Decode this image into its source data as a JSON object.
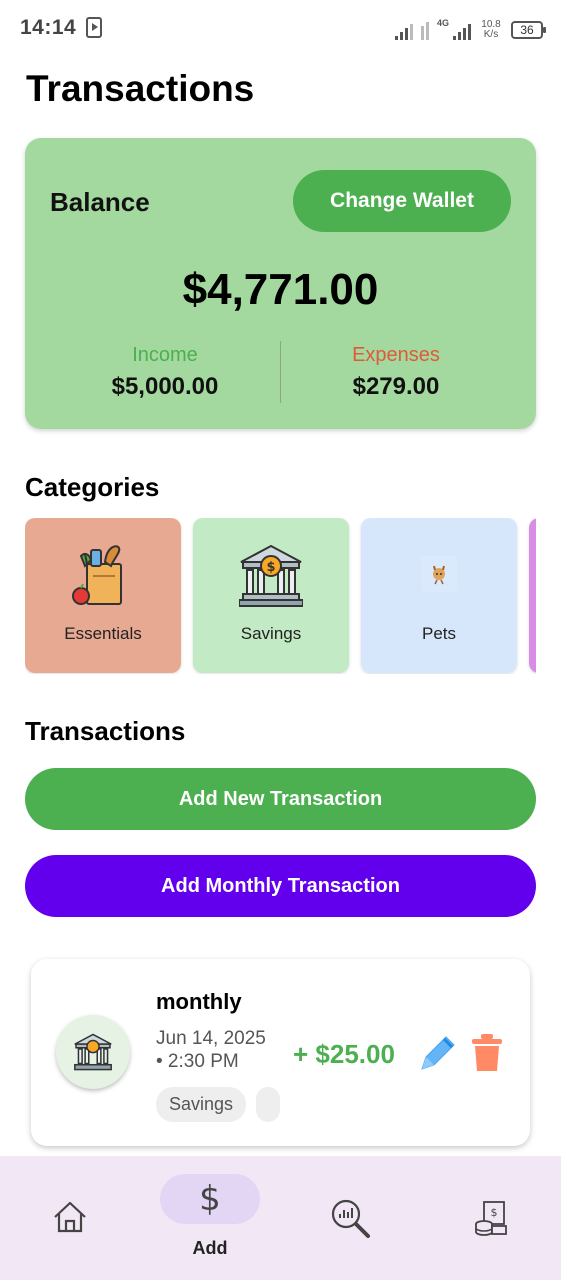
{
  "status_bar": {
    "time": "14:14",
    "network": "4G",
    "speed_value": "10.8",
    "speed_unit": "K/s",
    "battery": "36"
  },
  "page": {
    "title": "Transactions"
  },
  "balance": {
    "label": "Balance",
    "change_wallet_label": "Change Wallet",
    "amount": "$4,771.00",
    "income_label": "Income",
    "income_value": "$5,000.00",
    "expenses_label": "Expenses",
    "expenses_value": "$279.00"
  },
  "categories": {
    "title": "Categories",
    "items": [
      {
        "label": "Essentials",
        "color": "#e8a993",
        "icon": "grocery-bag-icon"
      },
      {
        "label": "Savings",
        "color": "#c2eac4",
        "icon": "bank-icon"
      },
      {
        "label": "Pets",
        "color": "#d6e7fc",
        "icon": "pet-icon"
      },
      {
        "label": "",
        "color": "#d98ee6",
        "icon": ""
      }
    ]
  },
  "transactions": {
    "title": "Transactions",
    "add_new_label": "Add New Transaction",
    "add_monthly_label": "Add Monthly Transaction",
    "items": [
      {
        "title": "monthly",
        "date": "Jun 14, 2025",
        "time": "• 2:30 PM",
        "amount": "+ $25.00",
        "tags": [
          "Savings",
          ""
        ],
        "icon": "bank-icon"
      }
    ]
  },
  "bottom_nav": {
    "items": [
      {
        "icon": "home-icon",
        "label": ""
      },
      {
        "icon": "dollar-icon",
        "label": "Add",
        "selected": true
      },
      {
        "icon": "analytics-search-icon",
        "label": ""
      },
      {
        "icon": "budget-icon",
        "label": ""
      }
    ]
  },
  "colors": {
    "primary_green": "#4caf50",
    "card_green": "#a3d99f",
    "purple": "#6200ee",
    "expenses_red": "#e05a3a",
    "nav_background": "#f2e8f5"
  }
}
